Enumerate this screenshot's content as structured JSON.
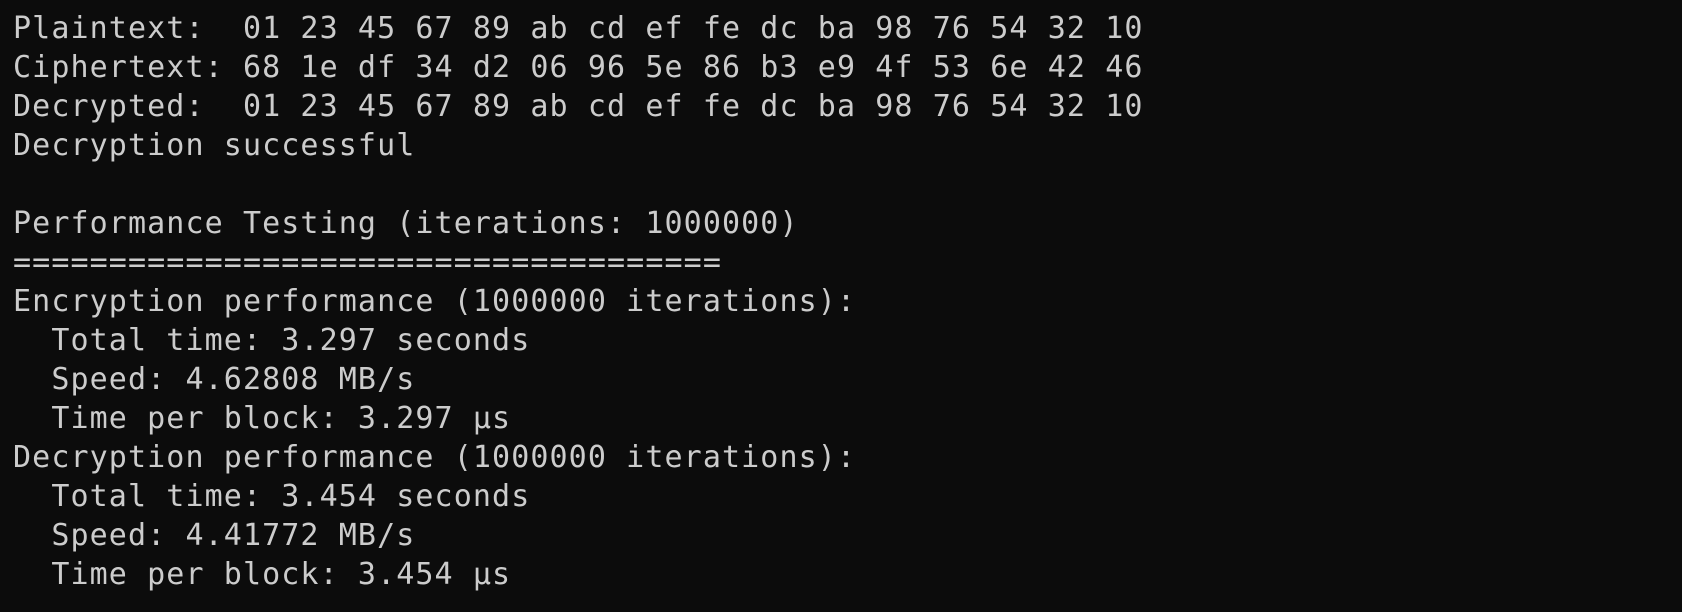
{
  "terminal": {
    "background": "#0c0c0c",
    "foreground": "#cccccc",
    "lines": [
      "Plaintext:  01 23 45 67 89 ab cd ef fe dc ba 98 76 54 32 10",
      "Ciphertext: 68 1e df 34 d2 06 96 5e 86 b3 e9 4f 53 6e 42 46",
      "Decrypted:  01 23 45 67 89 ab cd ef fe dc ba 98 76 54 32 10",
      "Decryption successful",
      "",
      "Performance Testing (iterations: 1000000)",
      "=====================================",
      "Encryption performance (1000000 iterations):",
      "  Total time: 3.297 seconds",
      "  Speed: 4.62808 MB/s",
      "  Time per block: 3.297 μs",
      "Decryption performance (1000000 iterations):",
      "  Total time: 3.454 seconds",
      "  Speed: 4.41772 MB/s",
      "  Time per block: 3.454 μs"
    ]
  }
}
